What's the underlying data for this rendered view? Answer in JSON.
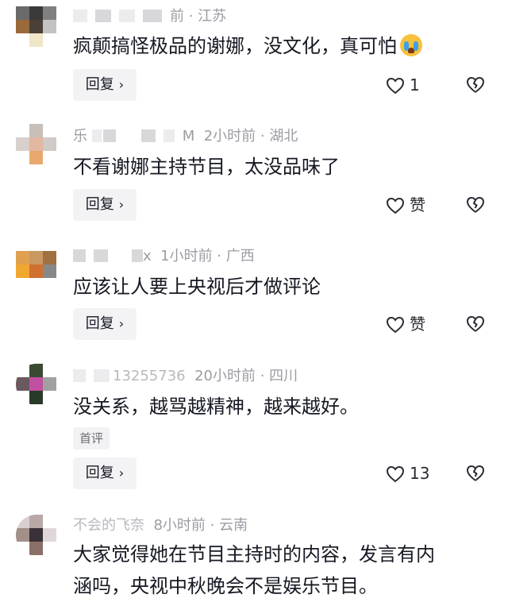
{
  "comments": [
    {
      "meta": "前 · 江苏",
      "text": "疯颠搞怪极品的谢娜，没文化，真可怕",
      "emoji": "loudly-crying-face",
      "reply_label": "回复",
      "like_label": "1",
      "tag": null
    },
    {
      "meta": "2小时前 · 湖北",
      "name_fragment_a": "乐",
      "name_fragment_b": "M",
      "text": "不看谢娜主持节目，太没品味了",
      "reply_label": "回复",
      "like_label": "赞",
      "tag": null
    },
    {
      "meta": "1小时前 · 广西",
      "name_fragment": "x",
      "text": "应该让人要上央视后才做评论",
      "reply_label": "回复",
      "like_label": "赞",
      "tag": null
    },
    {
      "meta": "20小时前 · 四川",
      "name_fragment": "13255736",
      "text": "没关系，越骂越精神，越来越好。",
      "reply_label": "回复",
      "like_label": "13",
      "tag": "首评"
    },
    {
      "meta": "8小时前 · 云南",
      "name_fragment": "不会的飞奈",
      "text_line1": "大家觉得她在节目主持时的内容，发言有内",
      "text_line2": "涵吗，央视中秋晚会不是娱乐节目。"
    }
  ],
  "colors": {
    "primary_text": "#161823",
    "meta_text": "#9b9ca3",
    "button_bg": "#f3f3f5"
  },
  "icons": {
    "like": "heart-outline-icon",
    "dislike": "broken-heart-icon",
    "reply_chevron": "chevron-right-icon"
  }
}
